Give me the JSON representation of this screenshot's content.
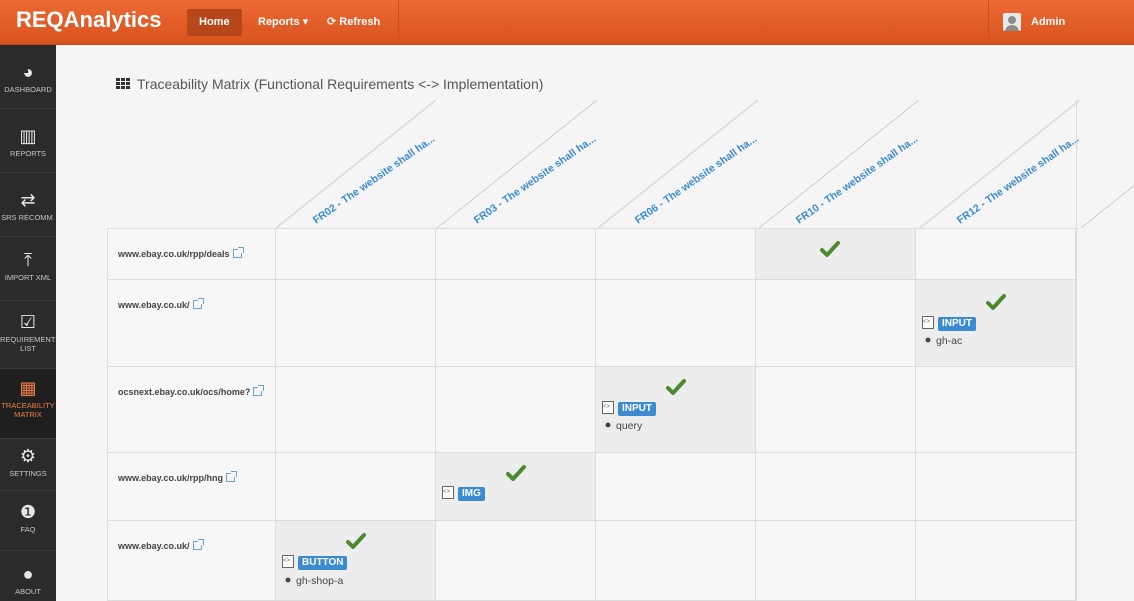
{
  "app": {
    "brand": "REQAnalytics"
  },
  "topnav": {
    "home": "Home",
    "reports": "Reports ▾",
    "refresh": "⟳ Refresh",
    "admin": "Admin"
  },
  "sidebar": {
    "items": [
      {
        "label": "DASHBOARD",
        "icon": "◕",
        "active": false
      },
      {
        "label": "REPORTS",
        "icon": "▥",
        "active": false
      },
      {
        "label": "SRS RECOMM.",
        "icon": "⇄",
        "active": false
      },
      {
        "label": "IMPORT XML",
        "icon": "⤒",
        "active": false
      },
      {
        "label": "REQUIREMENTS LIST",
        "icon": "☑",
        "active": false
      },
      {
        "label": "TRACEABILITY MATRIX",
        "icon": "▦",
        "active": true
      },
      {
        "label": "SETTINGS",
        "icon": "⚙",
        "active": false
      },
      {
        "label": "FAQ",
        "icon": "❶",
        "active": false
      },
      {
        "label": "ABOUT",
        "icon": "●",
        "active": false
      }
    ]
  },
  "page": {
    "title": "Traceability Matrix (Functional Requirements <-> Implementation)"
  },
  "matrix": {
    "columns": [
      "FR02 - The website shall ha...",
      "FR03 - The website shall ha...",
      "FR06 - The website shall ha...",
      "FR10 - The website shall ha...",
      "FR12 - The website shall ha..."
    ],
    "rows": [
      {
        "url": "www.ebay.co.uk/rpp/deals"
      },
      {
        "url": "www.ebay.co.uk/"
      },
      {
        "url": "ocsnext.ebay.co.uk/ocs/home?"
      },
      {
        "url": "www.ebay.co.uk/rpp/hng"
      },
      {
        "url": "www.ebay.co.uk/"
      }
    ],
    "hits": [
      {
        "row": 0,
        "col": 3,
        "tag": "",
        "selector": ""
      },
      {
        "row": 1,
        "col": 4,
        "tag": "INPUT",
        "selector": "gh-ac"
      },
      {
        "row": 2,
        "col": 2,
        "tag": "INPUT",
        "selector": "query"
      },
      {
        "row": 3,
        "col": 1,
        "tag": "IMG",
        "selector": ""
      },
      {
        "row": 4,
        "col": 0,
        "tag": "BUTTON",
        "selector": "gh-shop-a"
      }
    ]
  },
  "colors": {
    "accent": "#e8632c",
    "link": "#3a8bd2",
    "check": "#4c8a2f",
    "sidebar": "#2b2b2b"
  }
}
